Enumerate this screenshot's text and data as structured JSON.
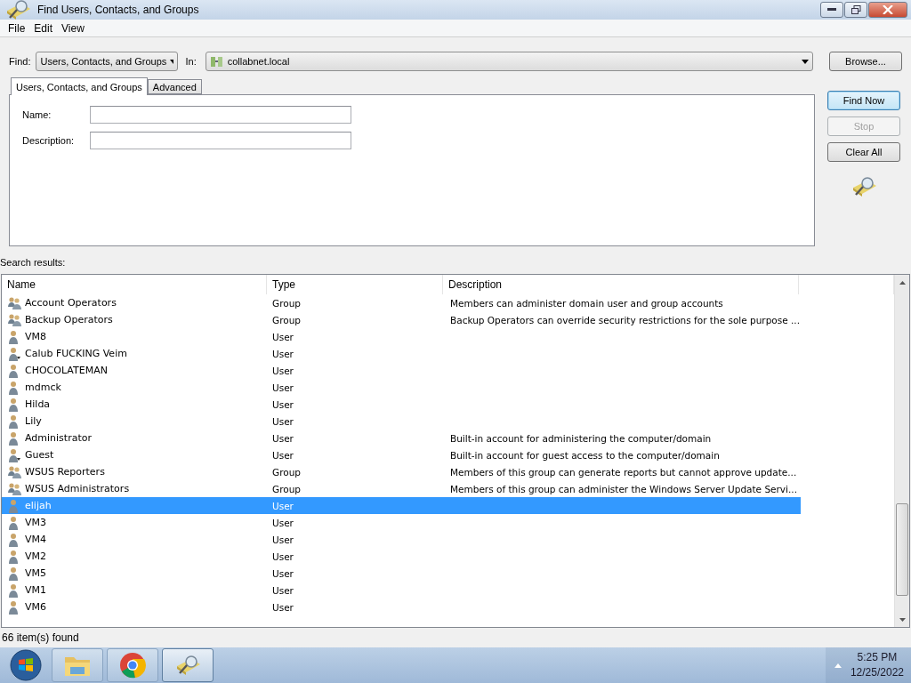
{
  "window": {
    "title": "Find Users, Contacts, and Groups"
  },
  "menu": [
    "File",
    "Edit",
    "View"
  ],
  "find": {
    "label": "Find:",
    "value": "Users, Contacts, and Groups"
  },
  "in": {
    "label": "In:",
    "value": "collabnet.local"
  },
  "browse_button": "Browse...",
  "tabs": [
    {
      "label": "Users, Contacts, and Groups",
      "selected": true
    },
    {
      "label": "Advanced",
      "selected": false
    }
  ],
  "fields": [
    {
      "label": "Name:"
    },
    {
      "label": "Description:"
    }
  ],
  "buttons": [
    {
      "label": "Find Now",
      "disabled": false,
      "default": true
    },
    {
      "label": "Stop",
      "disabled": true,
      "default": false
    },
    {
      "label": "Clear All",
      "disabled": false,
      "default": false
    }
  ],
  "results": {
    "label": "Search results:",
    "columns": [
      "Name",
      "Type",
      "Description"
    ],
    "rows": [
      {
        "name": "Account Operators",
        "type": "Group",
        "description": "Members can administer domain user and group accounts",
        "kind": "group",
        "selected": false
      },
      {
        "name": "Backup Operators",
        "type": "Group",
        "description": "Backup Operators can override security restrictions for the sole purpose ...",
        "kind": "group",
        "selected": false
      },
      {
        "name": "VM8",
        "type": "User",
        "kind": "user",
        "selected": false
      },
      {
        "name": "Calub FUCKING Veim",
        "type": "User",
        "kind": "disabled-user",
        "selected": false
      },
      {
        "name": "CHOCOLATEMAN",
        "type": "User",
        "kind": "user",
        "selected": false
      },
      {
        "name": "mdmck",
        "type": "User",
        "kind": "user",
        "selected": false
      },
      {
        "name": "Hilda",
        "type": "User",
        "kind": "user",
        "selected": false
      },
      {
        "name": "Lily",
        "type": "User",
        "kind": "user",
        "selected": false
      },
      {
        "name": "Administrator",
        "type": "User",
        "description": "Built-in account for administering the computer/domain",
        "kind": "user",
        "selected": false
      },
      {
        "name": "Guest",
        "type": "User",
        "description": "Built-in account for guest access to the computer/domain",
        "kind": "disabled-user",
        "selected": false
      },
      {
        "name": "WSUS Reporters",
        "type": "Group",
        "description": "Members of this group can generate reports but cannot approve update...",
        "kind": "group",
        "selected": false
      },
      {
        "name": "WSUS Administrators",
        "type": "Group",
        "description": "Members of this group can administer the Windows Server Update Servi...",
        "kind": "group",
        "selected": false
      },
      {
        "name": "elijah",
        "type": "User",
        "kind": "user",
        "selected": true
      },
      {
        "name": "VM3",
        "type": "User",
        "kind": "user",
        "selected": false
      },
      {
        "name": "VM4",
        "type": "User",
        "kind": "user",
        "selected": false
      },
      {
        "name": "VM2",
        "type": "User",
        "kind": "user",
        "selected": false
      },
      {
        "name": "VM5",
        "type": "User",
        "kind": "user",
        "selected": false
      },
      {
        "name": "VM1",
        "type": "User",
        "kind": "user",
        "selected": false
      },
      {
        "name": "VM6",
        "type": "User",
        "kind": "user",
        "selected": false
      }
    ]
  },
  "status_bar": "66 item(s) found",
  "taskbar": {
    "apps": [
      {
        "kind": "folder",
        "active": false
      },
      {
        "kind": "browser",
        "active": false
      },
      {
        "kind": "search",
        "active": true
      }
    ],
    "time": "5:25 PM",
    "date": "12/25/2022"
  }
}
